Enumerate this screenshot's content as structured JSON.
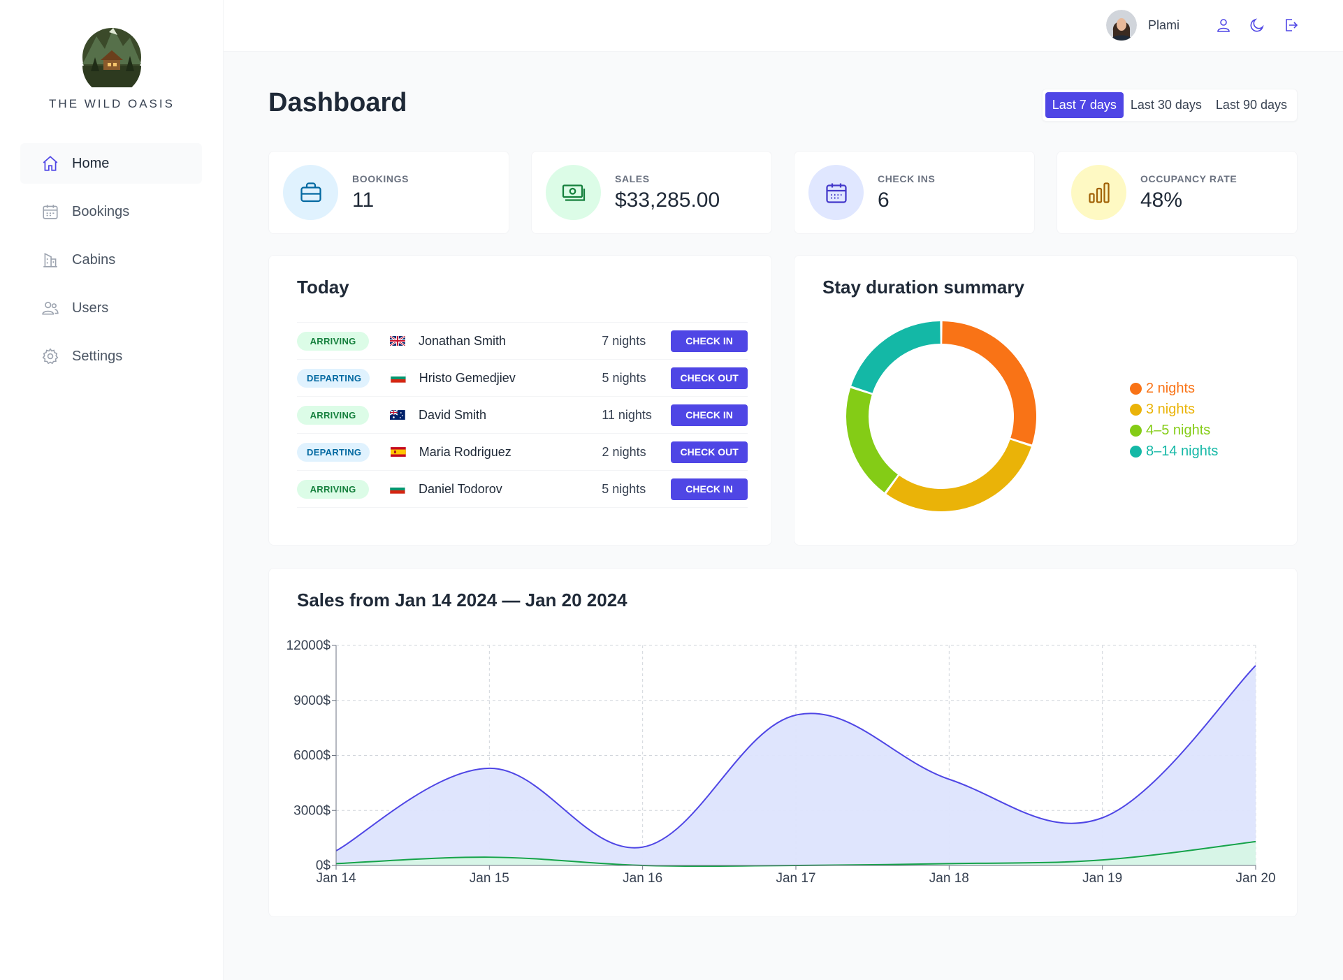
{
  "app": {
    "name": "THE WILD OASIS"
  },
  "sidebar": {
    "items": [
      {
        "label": "Home",
        "icon": "home-icon",
        "active": true
      },
      {
        "label": "Bookings",
        "icon": "calendar-icon",
        "active": false
      },
      {
        "label": "Cabins",
        "icon": "building-icon",
        "active": false
      },
      {
        "label": "Users",
        "icon": "users-icon",
        "active": false
      },
      {
        "label": "Settings",
        "icon": "gear-icon",
        "active": false
      }
    ]
  },
  "header": {
    "user_name": "Plami",
    "icons": [
      "user-icon",
      "moon-icon",
      "logout-icon"
    ]
  },
  "page": {
    "title": "Dashboard"
  },
  "filter": {
    "options": [
      "Last 7 days",
      "Last 30 days",
      "Last 90 days"
    ],
    "active": "Last 7 days"
  },
  "stats": [
    {
      "label": "BOOKINGS",
      "value": "11",
      "icon": "briefcase-icon",
      "color": "#0369a1",
      "bg": "#e0f2fe"
    },
    {
      "label": "SALES",
      "value": "$33,285.00",
      "icon": "banknotes-icon",
      "color": "#15803d",
      "bg": "#dcfce7"
    },
    {
      "label": "CHECK INS",
      "value": "6",
      "icon": "calendar-days-icon",
      "color": "#4338ca",
      "bg": "#e0e7ff"
    },
    {
      "label": "OCCUPANCY RATE",
      "value": "48%",
      "icon": "chart-bar-icon",
      "color": "#a16207",
      "bg": "#fef9c3"
    }
  ],
  "today": {
    "title": "Today",
    "rows": [
      {
        "status": "ARRIVING",
        "flag": "uk",
        "guest": "Jonathan Smith",
        "nights": "7 nights",
        "action": "CHECK IN"
      },
      {
        "status": "DEPARTING",
        "flag": "bg",
        "guest": "Hristo Gemedjiev",
        "nights": "5 nights",
        "action": "CHECK OUT"
      },
      {
        "status": "ARRIVING",
        "flag": "au",
        "guest": "David Smith",
        "nights": "11 nights",
        "action": "CHECK IN"
      },
      {
        "status": "DEPARTING",
        "flag": "es",
        "guest": "Maria Rodriguez",
        "nights": "2 nights",
        "action": "CHECK OUT"
      },
      {
        "status": "ARRIVING",
        "flag": "bg",
        "guest": "Daniel Todorov",
        "nights": "5 nights",
        "action": "CHECK IN"
      }
    ]
  },
  "duration": {
    "title": "Stay duration summary",
    "chart_data": {
      "type": "pie",
      "categories": [
        "2 nights",
        "3 nights",
        "4-5 nights",
        "8-14 nights"
      ],
      "values": [
        3,
        3,
        2,
        2
      ],
      "colors": [
        "#f97316",
        "#eab308",
        "#84cc16",
        "#14b8a6"
      ]
    },
    "legend": [
      {
        "label": "2 nights",
        "color": "#f97316"
      },
      {
        "label": "3 nights",
        "color": "#eab308"
      },
      {
        "label": "4–5 nights",
        "color": "#84cc16"
      },
      {
        "label": "8–14 nights",
        "color": "#14b8a6"
      }
    ]
  },
  "sales": {
    "title": "Sales from Jan 14 2024 — Jan 20 2024",
    "chart_data": {
      "type": "area",
      "categories": [
        "Jan 14",
        "Jan 15",
        "Jan 16",
        "Jan 17",
        "Jan 18",
        "Jan 19",
        "Jan 20"
      ],
      "series": [
        {
          "values": [
            800,
            5300,
            1000,
            8200,
            4700,
            2600,
            10900
          ],
          "color": "#4f46e5",
          "fill": "#dde4fd"
        },
        {
          "values": [
            100,
            450,
            0,
            0,
            100,
            300,
            1300
          ],
          "color": "#16a34a",
          "fill": "#d6f5e6"
        }
      ],
      "yticks": [
        0,
        3000,
        6000,
        9000,
        12000
      ],
      "ytick_labels": [
        "0$",
        "3000$",
        "6000$",
        "9000$",
        "12000$"
      ],
      "ylim": [
        0,
        12000
      ],
      "grid": true
    }
  }
}
